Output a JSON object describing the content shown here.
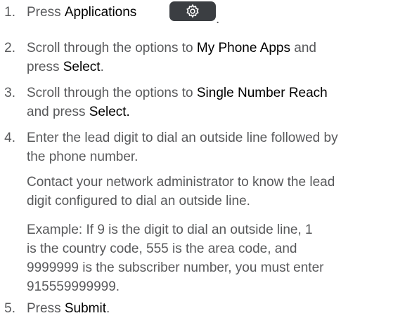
{
  "steps": [
    {
      "number": "1.",
      "pre": "Press ",
      "bold": "Applications",
      "post": "."
    },
    {
      "number": "2.",
      "line1_pre": "Scroll through the options to ",
      "line1_bold": "My Phone Apps",
      "line1_post": " and",
      "line2_pre": "press ",
      "line2_bold": "Select",
      "line2_post": "."
    },
    {
      "number": "3.",
      "line1_pre": "Scroll through the options to ",
      "line1_bold": "Single Number Reach",
      "line2_pre": "and press ",
      "line2_bold": "Select."
    },
    {
      "number": "4.",
      "line1": "Enter the lead digit to dial an outside line followed by",
      "line2": "the phone number.",
      "note1": "Contact your network administrator to know the lead",
      "note2": "digit configured to dial an outside line.",
      "example1": "Example: If 9 is the digit to dial an outside line, 1",
      "example2": "is the country code, 555 is the area code, and",
      "example3": "9999999 is the subscriber number, you must enter",
      "example4": "915559999999."
    },
    {
      "number": "5.",
      "pre": "Press ",
      "bold": "Submit",
      "post": "."
    }
  ],
  "icons": {
    "applications_button": "gear-icon",
    "button_color": "#3b3e42"
  }
}
